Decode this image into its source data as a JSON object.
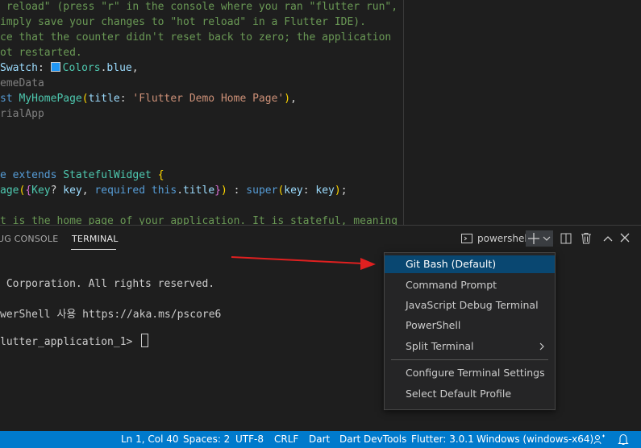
{
  "editor": {
    "lines": [
      {
        "t": [
          [
            "c-comment",
            " reload\" (press \"r\" in the console where you ran \"flutter run\","
          ]
        ]
      },
      {
        "t": [
          [
            "c-comment",
            "imply save your changes to \"hot reload\" in a Flutter IDE)."
          ]
        ]
      },
      {
        "t": [
          [
            "c-comment",
            "ce that the counter didn't reset back to zero; the application"
          ]
        ]
      },
      {
        "t": [
          [
            "c-comment",
            "ot restarted."
          ]
        ]
      },
      {
        "t": [
          [
            "c-ident",
            "Swatch"
          ],
          [
            "c-punc",
            ": "
          ],
          [
            "swatch",
            ""
          ],
          [
            "c-cls",
            "Colors"
          ],
          [
            "c-punc",
            "."
          ],
          [
            "c-ident",
            "blue"
          ],
          [
            "c-punc",
            ","
          ]
        ]
      },
      {
        "t": [
          [
            "c-dim",
            "emeData"
          ]
        ]
      },
      {
        "t": [
          [
            "c-kw",
            "st "
          ],
          [
            "c-cls",
            "MyHomePage"
          ],
          [
            "c-br",
            "("
          ],
          [
            "c-ident",
            "title"
          ],
          [
            "c-punc",
            ": "
          ],
          [
            "c-str",
            "'Flutter Demo Home Page'"
          ],
          [
            "c-br",
            ")"
          ],
          [
            "c-punc",
            ","
          ]
        ]
      },
      {
        "t": [
          [
            "c-dim",
            "rialApp"
          ]
        ]
      },
      {
        "t": []
      },
      {
        "t": []
      },
      {
        "t": []
      },
      {
        "t": [
          [
            "c-kw",
            "e "
          ],
          [
            "c-kw",
            "extends "
          ],
          [
            "c-cls",
            "StatefulWidget "
          ],
          [
            "c-br",
            "{"
          ]
        ]
      },
      {
        "t": [
          [
            "c-cls",
            "age"
          ],
          [
            "c-br",
            "("
          ],
          [
            "c-br2",
            "{"
          ],
          [
            "c-cls",
            "Key"
          ],
          [
            "c-punc",
            "? "
          ],
          [
            "c-ident",
            "key"
          ],
          [
            "c-punc",
            ", "
          ],
          [
            "c-kw",
            "required "
          ],
          [
            "c-kw",
            "this"
          ],
          [
            "c-punc",
            "."
          ],
          [
            "c-ident",
            "title"
          ],
          [
            "c-br2",
            "}"
          ],
          [
            "c-br",
            ")"
          ],
          [
            "c-punc",
            " : "
          ],
          [
            "c-kw",
            "super"
          ],
          [
            "c-br",
            "("
          ],
          [
            "c-ident",
            "key"
          ],
          [
            "c-punc",
            ": "
          ],
          [
            "c-ident",
            "key"
          ],
          [
            "c-br",
            ")"
          ],
          [
            "c-punc",
            ";"
          ]
        ]
      },
      {
        "t": []
      },
      {
        "t": [
          [
            "c-comment",
            "t is the home page of your application. It is stateful, meaning"
          ]
        ]
      }
    ]
  },
  "panel": {
    "tabs": {
      "debug_console": "UG CONSOLE",
      "terminal": "TERMINAL"
    },
    "toolbar": {
      "shell_label": "powershell"
    },
    "terminal_lines": [
      " Corporation. All rights reserved.",
      "",
      "werShell 사용 https://aka.ms/pscore6",
      "",
      "lutter_application_1> "
    ]
  },
  "dropdown": {
    "items": [
      {
        "label": "Git Bash (Default)",
        "selected": true
      },
      {
        "label": "Command Prompt"
      },
      {
        "label": "JavaScript Debug Terminal"
      },
      {
        "label": "PowerShell"
      },
      {
        "label": "Split Terminal",
        "submenu": true
      }
    ],
    "items2": [
      {
        "label": "Configure Terminal Settings"
      },
      {
        "label": "Select Default Profile"
      }
    ]
  },
  "status": {
    "position": "Ln 1, Col 40",
    "spaces": "Spaces: 2",
    "encoding": "UTF-8",
    "eol": "CRLF",
    "language": "Dart",
    "devtools": "Dart DevTools",
    "flutter": "Flutter: 3.0.1",
    "device": "Windows (windows-x64)"
  },
  "colors": {
    "accent": "#007acc",
    "selected": "#094771",
    "arrow": "#e02020"
  }
}
